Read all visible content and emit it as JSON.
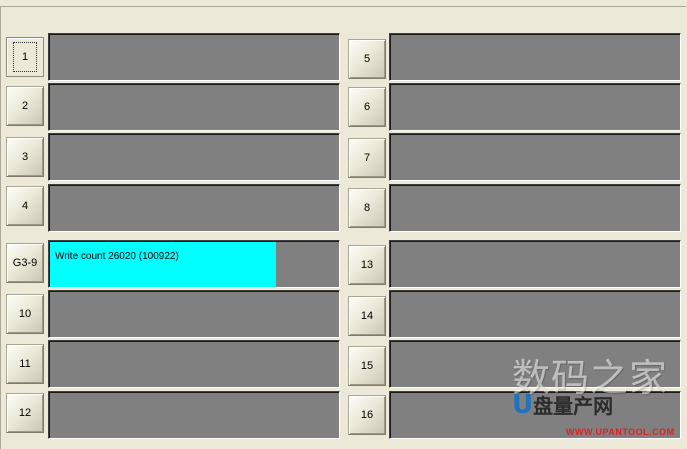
{
  "left_column": [
    {
      "label": "1",
      "pressed": true,
      "text": ""
    },
    {
      "label": "2",
      "text": ""
    },
    {
      "label": "3",
      "text": ""
    },
    {
      "label": "4",
      "text": ""
    },
    {
      "label": "G3-9",
      "text": "Write count 26020 (100922)",
      "progress": 0.78
    },
    {
      "label": "10",
      "text": ""
    },
    {
      "label": "11",
      "text": ""
    },
    {
      "label": "12",
      "text": ""
    }
  ],
  "right_column": [
    {
      "label": "5",
      "text": ""
    },
    {
      "label": "6",
      "text": ""
    },
    {
      "label": "7",
      "text": ""
    },
    {
      "label": "8",
      "text": ""
    },
    {
      "label": "13",
      "text": ""
    },
    {
      "label": "14",
      "text": ""
    },
    {
      "label": "15",
      "text": ""
    },
    {
      "label": "16",
      "text": ""
    }
  ],
  "colors": {
    "slot_bg": "#808080",
    "progress_fill": "#00ffff",
    "window_bg": "#ece9d8"
  },
  "watermark": {
    "cn_text": "数码之家",
    "logo_left": "U",
    "logo_mid": "盘量产网",
    "url": "WWW.UPANTOOL.COM"
  }
}
